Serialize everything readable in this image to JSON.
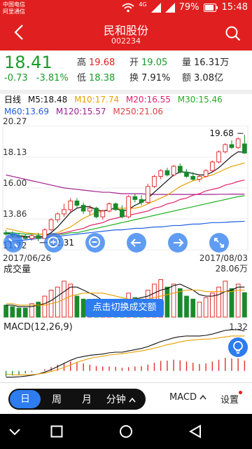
{
  "status_bar": {
    "carrier_1": "中国电信",
    "carrier_2": "阿里通信",
    "network": "4G",
    "battery": "79%",
    "time": "15:48"
  },
  "header": {
    "title": "民和股份",
    "code": "002234"
  },
  "quote": {
    "price": "18.41",
    "change": "-0.73",
    "change_pct": "-3.81%",
    "high_label": "高",
    "high": "19.68",
    "open_label": "开",
    "open": "19.05",
    "volume_label": "量",
    "volume": "16.31万",
    "low_label": "低",
    "low": "18.38",
    "turnover_label": "换",
    "turnover": "7.91%",
    "amount_label": "额",
    "amount": "3.08亿"
  },
  "ma_legend": {
    "period": "日线",
    "m5": "M5:18.48",
    "m10": "M10:17.74",
    "m20": "M20:16.55",
    "m30": "M30:15.46",
    "m60": "M60:13.69",
    "m120": "M120:15.57",
    "m250": "M250:21.06",
    "colors": {
      "m5": "#111111",
      "m10": "#e8a000",
      "m20": "#e0206a",
      "m30": "#20b020",
      "m60": "#2060e0",
      "m120": "#a02090",
      "m250": "#e04040"
    }
  },
  "chart_data": [
    {
      "type": "candlestick",
      "title": "",
      "y_ticks": [
        "20.27",
        "18.13",
        "16.00",
        "13.86",
        "11.72"
      ],
      "ylim": [
        11.72,
        20.27
      ],
      "x_start_label": "2017/06/26",
      "x_end_label": "2017/08/03",
      "annotations": [
        {
          "label": "19.68",
          "kind": "high",
          "index": 37
        },
        {
          "label": "12.31",
          "kind": "low",
          "index": 5
        }
      ],
      "candles": [
        {
          "o": 12.9,
          "h": 13.1,
          "l": 12.7,
          "c": 12.8
        },
        {
          "o": 12.8,
          "h": 13.0,
          "l": 12.6,
          "c": 12.7
        },
        {
          "o": 12.7,
          "h": 12.9,
          "l": 12.5,
          "c": 12.6
        },
        {
          "o": 12.6,
          "h": 12.8,
          "l": 12.4,
          "c": 12.5
        },
        {
          "o": 12.5,
          "h": 12.8,
          "l": 12.35,
          "c": 12.7
        },
        {
          "o": 12.7,
          "h": 12.9,
          "l": 12.31,
          "c": 12.5
        },
        {
          "o": 12.5,
          "h": 13.2,
          "l": 12.5,
          "c": 13.1
        },
        {
          "o": 13.1,
          "h": 13.9,
          "l": 13.0,
          "c": 13.8
        },
        {
          "o": 13.8,
          "h": 14.3,
          "l": 13.6,
          "c": 14.2
        },
        {
          "o": 14.2,
          "h": 14.9,
          "l": 14.0,
          "c": 14.5
        },
        {
          "o": 14.5,
          "h": 15.3,
          "l": 14.3,
          "c": 15.1
        },
        {
          "o": 15.1,
          "h": 15.3,
          "l": 14.6,
          "c": 14.8
        },
        {
          "o": 14.8,
          "h": 15.0,
          "l": 14.2,
          "c": 14.4
        },
        {
          "o": 14.4,
          "h": 14.8,
          "l": 14.1,
          "c": 14.6
        },
        {
          "o": 14.6,
          "h": 14.7,
          "l": 13.9,
          "c": 14.0
        },
        {
          "o": 14.0,
          "h": 14.5,
          "l": 13.8,
          "c": 14.4
        },
        {
          "o": 14.4,
          "h": 15.0,
          "l": 14.3,
          "c": 14.9
        },
        {
          "o": 14.9,
          "h": 15.0,
          "l": 14.4,
          "c": 14.5
        },
        {
          "o": 14.5,
          "h": 14.8,
          "l": 13.9,
          "c": 14.0
        },
        {
          "o": 14.0,
          "h": 15.5,
          "l": 13.9,
          "c": 15.4
        },
        {
          "o": 15.4,
          "h": 15.6,
          "l": 15.0,
          "c": 15.2
        },
        {
          "o": 15.2,
          "h": 15.5,
          "l": 14.8,
          "c": 15.0
        },
        {
          "o": 15.0,
          "h": 16.3,
          "l": 14.9,
          "c": 16.1
        },
        {
          "o": 16.1,
          "h": 16.9,
          "l": 16.0,
          "c": 16.8
        },
        {
          "o": 16.8,
          "h": 17.3,
          "l": 16.6,
          "c": 17.2
        },
        {
          "o": 17.2,
          "h": 17.4,
          "l": 16.8,
          "c": 16.9
        },
        {
          "o": 16.9,
          "h": 17.6,
          "l": 16.8,
          "c": 17.5
        },
        {
          "o": 17.5,
          "h": 17.7,
          "l": 17.0,
          "c": 17.1
        },
        {
          "o": 17.1,
          "h": 17.3,
          "l": 16.7,
          "c": 16.8
        },
        {
          "o": 16.8,
          "h": 17.1,
          "l": 16.5,
          "c": 16.6
        },
        {
          "o": 16.6,
          "h": 16.9,
          "l": 16.4,
          "c": 16.8
        },
        {
          "o": 16.8,
          "h": 17.3,
          "l": 16.7,
          "c": 17.2
        },
        {
          "o": 17.2,
          "h": 17.9,
          "l": 17.1,
          "c": 17.8
        },
        {
          "o": 17.8,
          "h": 18.6,
          "l": 17.7,
          "c": 18.5
        },
        {
          "o": 18.5,
          "h": 19.1,
          "l": 18.4,
          "c": 19.0
        },
        {
          "o": 19.0,
          "h": 19.3,
          "l": 18.7,
          "c": 18.8
        },
        {
          "o": 18.8,
          "h": 19.5,
          "l": 18.7,
          "c": 19.4
        },
        {
          "o": 19.05,
          "h": 19.68,
          "l": 18.38,
          "c": 18.41
        }
      ],
      "moving_averages": {
        "m5": [
          12.9,
          12.8,
          12.7,
          12.65,
          12.6,
          12.6,
          12.65,
          12.9,
          13.3,
          13.8,
          14.3,
          14.6,
          14.7,
          14.7,
          14.5,
          14.4,
          14.5,
          14.6,
          14.4,
          14.5,
          14.8,
          15.0,
          15.3,
          15.7,
          16.1,
          16.5,
          16.9,
          17.1,
          17.1,
          17.0,
          16.9,
          16.9,
          17.1,
          17.4,
          17.8,
          18.2,
          18.5,
          18.48
        ],
        "m10": [
          13.2,
          13.1,
          13.0,
          12.9,
          12.85,
          12.8,
          12.8,
          12.8,
          12.9,
          13.1,
          13.3,
          13.6,
          13.9,
          14.1,
          14.3,
          14.4,
          14.5,
          14.6,
          14.6,
          14.6,
          14.6,
          14.7,
          14.9,
          15.1,
          15.3,
          15.5,
          15.8,
          16.1,
          16.3,
          16.5,
          16.6,
          16.8,
          16.9,
          17.1,
          17.3,
          17.5,
          17.6,
          17.74
        ],
        "m20": [
          12.6,
          12.6,
          12.6,
          12.6,
          12.6,
          12.6,
          12.6,
          12.7,
          12.8,
          12.9,
          13.0,
          13.1,
          13.2,
          13.4,
          13.5,
          13.6,
          13.8,
          13.9,
          14.0,
          14.1,
          14.2,
          14.3,
          14.4,
          14.6,
          14.7,
          14.9,
          15.0,
          15.2,
          15.3,
          15.5,
          15.6,
          15.8,
          15.9,
          16.0,
          16.2,
          16.3,
          16.45,
          16.55
        ],
        "m30": [
          12.9,
          12.9,
          12.85,
          12.8,
          12.8,
          12.8,
          12.8,
          12.8,
          12.8,
          12.8,
          12.9,
          12.9,
          13.0,
          13.1,
          13.2,
          13.3,
          13.4,
          13.5,
          13.6,
          13.7,
          13.8,
          13.9,
          14.0,
          14.1,
          14.2,
          14.3,
          14.4,
          14.5,
          14.6,
          14.7,
          14.8,
          14.9,
          15.0,
          15.1,
          15.2,
          15.3,
          15.4,
          15.46
        ],
        "m60": [
          12.3,
          12.3,
          12.35,
          12.4,
          12.45,
          12.5,
          12.55,
          12.6,
          12.65,
          12.7,
          12.75,
          12.8,
          12.85,
          12.9,
          12.95,
          13.0,
          13.05,
          13.1,
          13.1,
          13.15,
          13.2,
          13.2,
          13.25,
          13.3,
          13.3,
          13.35,
          13.4,
          13.4,
          13.45,
          13.5,
          13.5,
          13.55,
          13.6,
          13.6,
          13.62,
          13.65,
          13.67,
          13.69
        ],
        "m120": [
          16.9,
          16.8,
          16.7,
          16.6,
          16.5,
          16.4,
          16.3,
          16.2,
          16.1,
          16.0,
          15.95,
          15.9,
          15.85,
          15.8,
          15.75,
          15.7,
          15.7,
          15.65,
          15.6,
          15.6,
          15.6,
          15.6,
          15.55,
          15.55,
          15.55,
          15.55,
          15.55,
          15.55,
          15.55,
          15.55,
          15.55,
          15.55,
          15.55,
          15.56,
          15.56,
          15.57,
          15.57,
          15.57
        ]
      }
    },
    {
      "type": "bar",
      "title": "成交量",
      "max_label": "28.06万",
      "ylim": [
        0,
        28.06
      ],
      "values": [
        8,
        7,
        6,
        6,
        9,
        10,
        14,
        18,
        20,
        24,
        22,
        14,
        12,
        10,
        12,
        8,
        9,
        10,
        12,
        16,
        13,
        12,
        18,
        22,
        25,
        20,
        22,
        19,
        14,
        12,
        10,
        13,
        16,
        20,
        24,
        19,
        22,
        16.31
      ],
      "up": [
        0,
        0,
        0,
        0,
        1,
        0,
        1,
        1,
        1,
        1,
        1,
        0,
        0,
        1,
        0,
        1,
        1,
        0,
        0,
        1,
        0,
        0,
        1,
        1,
        1,
        0,
        1,
        0,
        0,
        0,
        1,
        1,
        1,
        1,
        1,
        0,
        1,
        0
      ],
      "vol_ma5": [
        8,
        8,
        7,
        7,
        7,
        8,
        9,
        11,
        14,
        17,
        20,
        20,
        18,
        16,
        14,
        11,
        10,
        10,
        10,
        11,
        12,
        13,
        14,
        16,
        18,
        19,
        21,
        22,
        20,
        18,
        15,
        14,
        14,
        15,
        17,
        18,
        20,
        20
      ],
      "vol_ma10": [
        9,
        9,
        8,
        8,
        8,
        8,
        8,
        9,
        10,
        12,
        14,
        15,
        16,
        16,
        16,
        16,
        15,
        14,
        13,
        12,
        12,
        12,
        12,
        13,
        14,
        15,
        16,
        17,
        18,
        18,
        18,
        17,
        17,
        17,
        17,
        17,
        18,
        18
      ]
    },
    {
      "type": "macd",
      "title": "MACD(12,26,9)",
      "max_label": "1.32",
      "ylim": [
        -0.3,
        1.32
      ],
      "hist": [
        -0.18,
        -0.15,
        -0.12,
        -0.08,
        -0.04,
        0.0,
        0.05,
        0.12,
        0.2,
        0.26,
        0.3,
        0.28,
        0.24,
        0.2,
        0.16,
        0.14,
        0.14,
        0.13,
        0.1,
        0.12,
        0.14,
        0.15,
        0.2,
        0.26,
        0.32,
        0.33,
        0.36,
        0.34,
        0.3,
        0.26,
        0.22,
        0.24,
        0.3,
        0.36,
        0.42,
        0.4,
        0.4,
        0.33
      ],
      "dif": [
        -0.2,
        -0.2,
        -0.19,
        -0.17,
        -0.14,
        -0.1,
        -0.04,
        0.04,
        0.14,
        0.24,
        0.34,
        0.42,
        0.46,
        0.5,
        0.52,
        0.54,
        0.58,
        0.6,
        0.6,
        0.64,
        0.68,
        0.72,
        0.78,
        0.86,
        0.94,
        1.0,
        1.06,
        1.1,
        1.12,
        1.12,
        1.12,
        1.14,
        1.18,
        1.24,
        1.3,
        1.32,
        1.32,
        1.28
      ],
      "dea": [
        -0.1,
        -0.12,
        -0.13,
        -0.13,
        -0.12,
        -0.1,
        -0.07,
        -0.02,
        0.04,
        0.11,
        0.19,
        0.28,
        0.34,
        0.4,
        0.44,
        0.47,
        0.51,
        0.53,
        0.55,
        0.58,
        0.61,
        0.64,
        0.68,
        0.73,
        0.78,
        0.84,
        0.88,
        0.93,
        0.97,
        0.99,
        1.01,
        1.02,
        1.03,
        1.06,
        1.09,
        1.12,
        1.12,
        1.12
      ]
    }
  ],
  "chart_controls": {
    "zoom_in": "zoom-in",
    "zoom_out": "zoom-out",
    "prev": "prev",
    "next": "next",
    "fullscreen": "fullscreen"
  },
  "hint_button": "点击切换成交额",
  "bottom_bar": {
    "periods": [
      "日",
      "周",
      "月",
      "分钟"
    ],
    "active_period": "日",
    "indicator": "MACD",
    "settings": "设置"
  },
  "colors": {
    "accent_red": "#e02020",
    "up_red": "#e03030",
    "down_green": "#1a8a2a",
    "button_blue": "#2d7cf0"
  }
}
